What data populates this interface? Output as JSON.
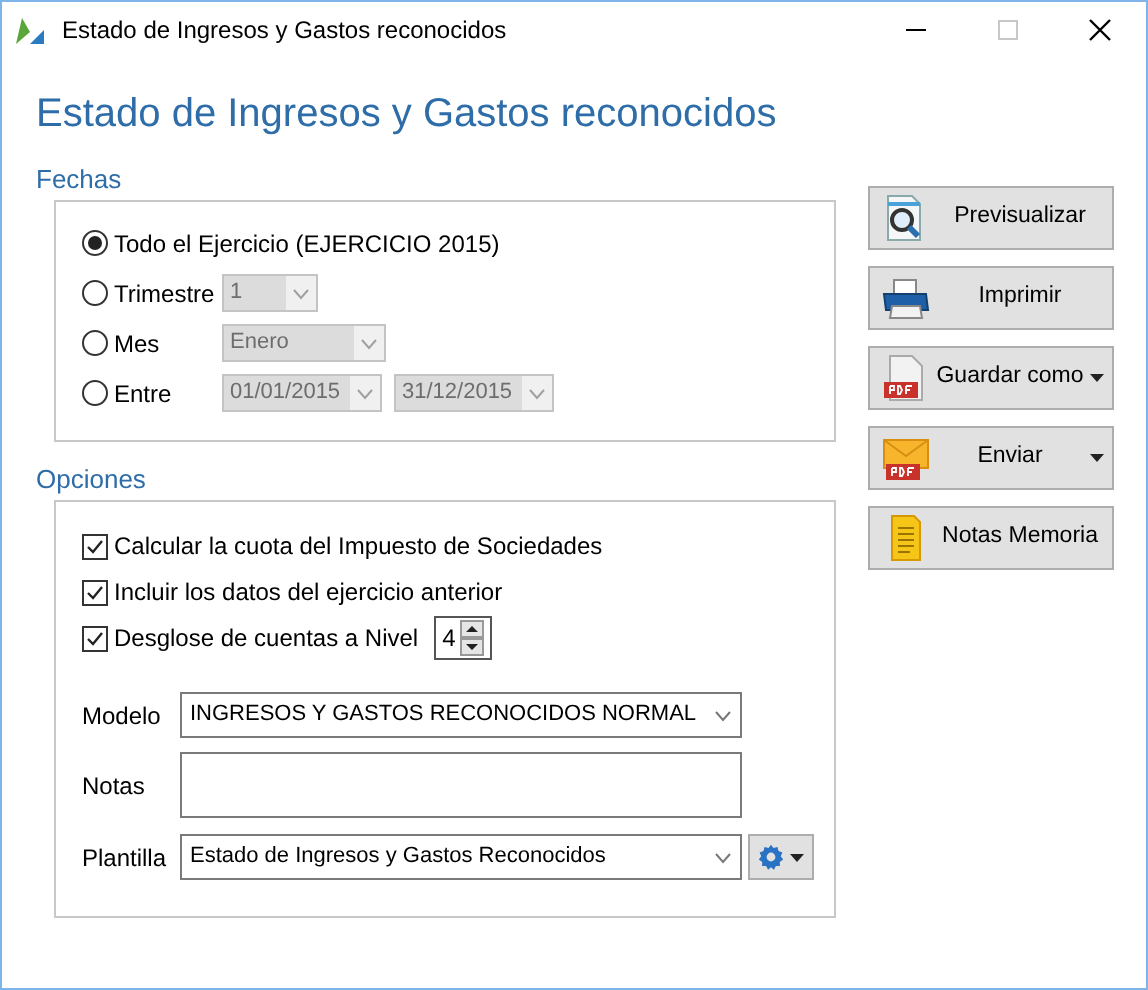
{
  "window": {
    "title": "Estado de Ingresos y Gastos reconocidos",
    "maximize_disabled": true
  },
  "heading": "Estado de Ingresos y Gastos reconocidos",
  "fechas": {
    "label": "Fechas",
    "options": [
      {
        "label": "Todo el Ejercicio (EJERCICIO 2015)",
        "selected": true
      },
      {
        "label": "Trimestre",
        "selected": false,
        "fields": [
          {
            "value": "1",
            "disabled": true
          }
        ]
      },
      {
        "label": "Mes",
        "selected": false,
        "fields": [
          {
            "value": "Enero",
            "disabled": true
          }
        ]
      },
      {
        "label": "Entre",
        "selected": false,
        "fields": [
          {
            "value": "01/01/2015",
            "disabled": true
          },
          {
            "value": "31/12/2015",
            "disabled": true
          }
        ]
      }
    ]
  },
  "opciones": {
    "label": "Opciones",
    "checkboxes": [
      {
        "label": "Calcular la cuota del Impuesto de Sociedades",
        "checked": true
      },
      {
        "label": "Incluir los datos del ejercicio anterior",
        "checked": true
      },
      {
        "label": "Desglose de cuentas a Nivel",
        "checked": true,
        "spinner": "4"
      }
    ],
    "modelo": {
      "label": "Modelo",
      "value": "INGRESOS Y GASTOS RECONOCIDOS NORMAL"
    },
    "notas": {
      "label": "Notas"
    },
    "plantilla": {
      "label": "Plantilla",
      "value": "Estado de Ingresos y Gastos Reconocidos"
    }
  },
  "buttons": [
    {
      "label": "Previsualizar",
      "dropdown": false
    },
    {
      "label": "Imprimir",
      "dropdown": false
    },
    {
      "label": "Guardar como",
      "dropdown": true
    },
    {
      "label": "Enviar",
      "dropdown": true
    },
    {
      "label": "Notas Memoria",
      "dropdown": false
    }
  ]
}
